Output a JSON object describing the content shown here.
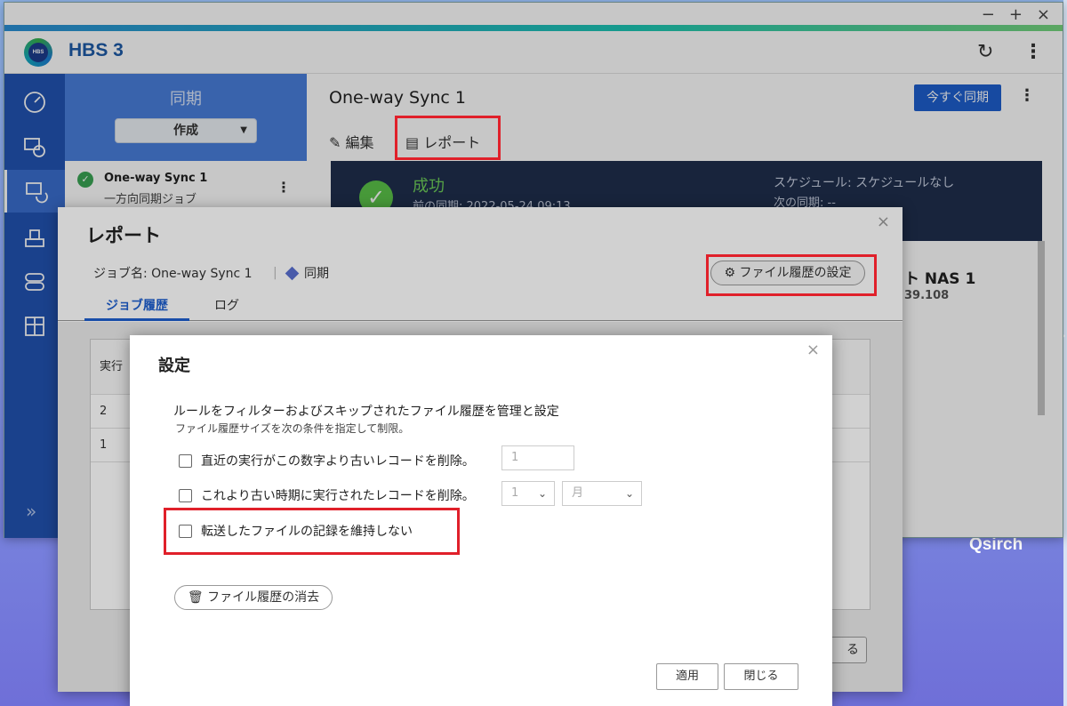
{
  "desktop": {
    "qsirch_label": "Qsirch"
  },
  "window": {
    "controls": [
      "−",
      "+",
      "×"
    ]
  },
  "app": {
    "title": "HBS 3"
  },
  "job_panel": {
    "heading": "同期",
    "create_label": "作成",
    "job": {
      "name": "One-way Sync 1",
      "subtitle": "一方向同期ジョブ"
    }
  },
  "main": {
    "title": "One-way Sync 1",
    "sync_now_label": "今すぐ同期",
    "tabs": {
      "edit": "編集",
      "report": "レポート"
    },
    "status": {
      "result": "成功",
      "last_sync": "前の同期: 2022-05-24 09:13",
      "schedule": "スケジュール: スケジュールなし",
      "next_sync": "次の同期: --"
    },
    "destination": {
      "name": "ト NAS 1",
      "address": "39.108"
    }
  },
  "report_dialog": {
    "title": "レポート",
    "job_name": "ジョブ名: One-way Sync 1",
    "separator": "|",
    "job_type": "同期",
    "file_history_button": "ファイル履歴の設定",
    "tabs": [
      "ジョブ履歴",
      "ログ"
    ],
    "table": {
      "header": "実行",
      "rows": [
        "2",
        "1"
      ]
    },
    "close_partial": "る"
  },
  "settings_dialog": {
    "title": "設定",
    "description": "ルールをフィルターおよびスキップされたファイル履歴を管理と設定",
    "sub_description": "ファイル履歴サイズを次の条件を指定して制限。",
    "option_recent": "直近の実行がこの数字より古いレコードを削除。",
    "recent_value": "1",
    "option_older": "これより古い時期に実行されたレコードを削除。",
    "older_amount": "1",
    "older_unit": "月",
    "option_no_keep": "転送したファイルの記録を維持しない",
    "clear_history_button": "ファイル履歴の消去",
    "apply_button": "適用",
    "close_button": "閉じる"
  },
  "colors": {
    "accent": "#1e5fcf",
    "highlight": "#e0202a",
    "nav": "#2254b4",
    "success": "#5bc54a"
  }
}
